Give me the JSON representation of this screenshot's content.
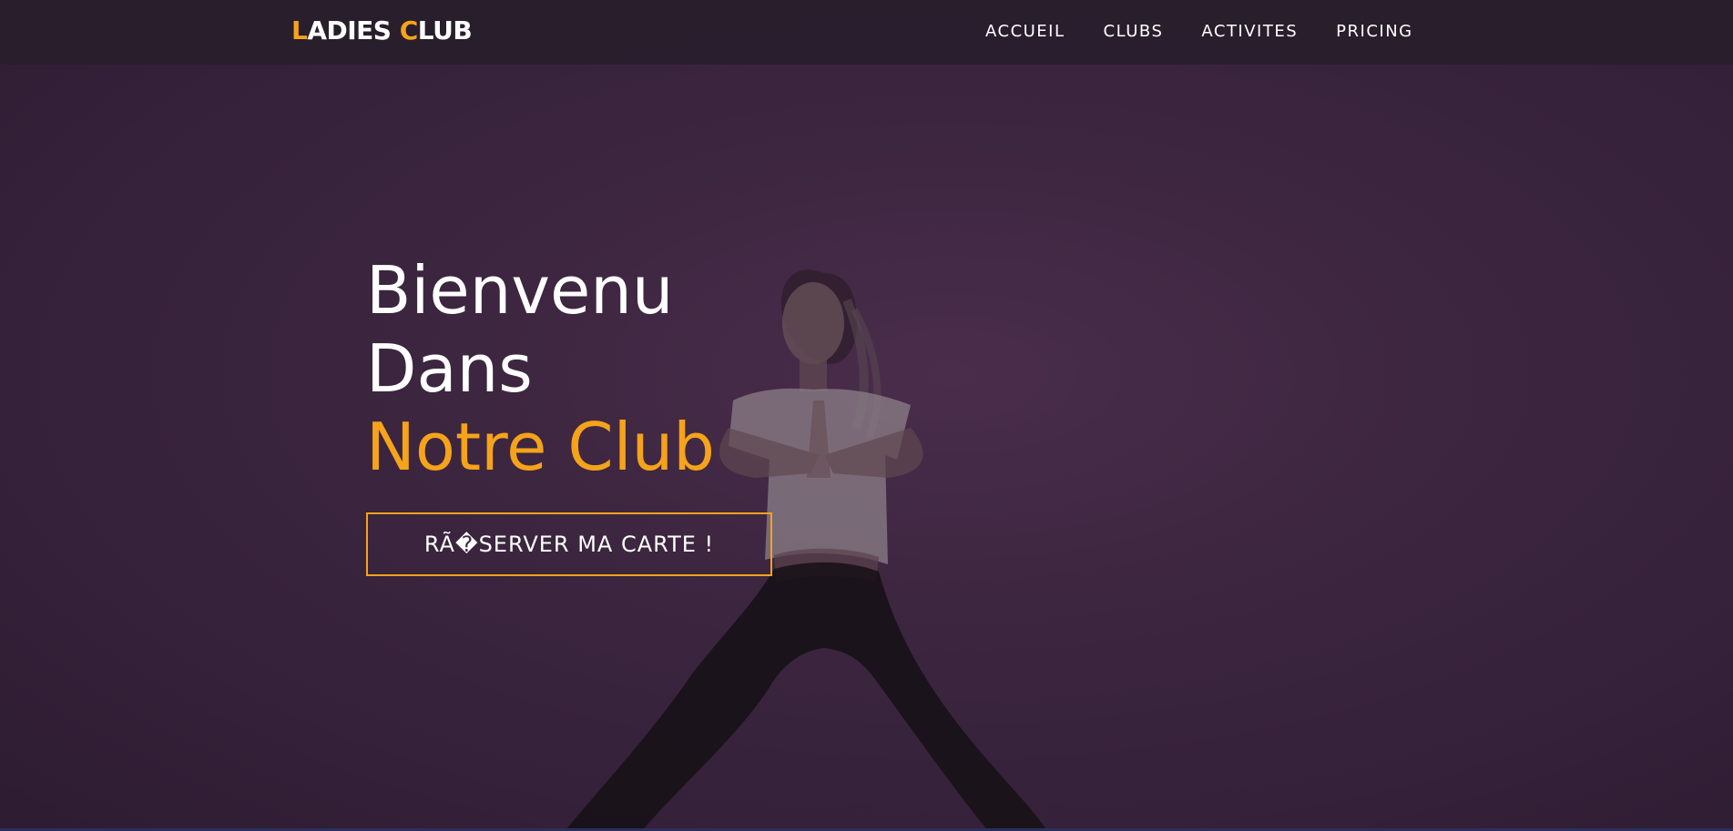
{
  "brand": {
    "first_letter": "L",
    "middle": "ADIES ",
    "second_letter": "C",
    "rest": "LUB"
  },
  "nav": {
    "items": [
      {
        "label": "ACCUEIL"
      },
      {
        "label": "CLUBS"
      },
      {
        "label": "ACTIVITES"
      },
      {
        "label": "PRICING"
      }
    ]
  },
  "hero": {
    "line1": "Bienvenu",
    "line2": "Dans",
    "line3": "Notre Club",
    "cta_label": "RÃ�SERVER MA CARTE !",
    "background_image": "woman-yoga-pose-photo"
  },
  "colors": {
    "accent": "#f5a31a",
    "background": "#3d2640",
    "text": "#ffffff"
  }
}
